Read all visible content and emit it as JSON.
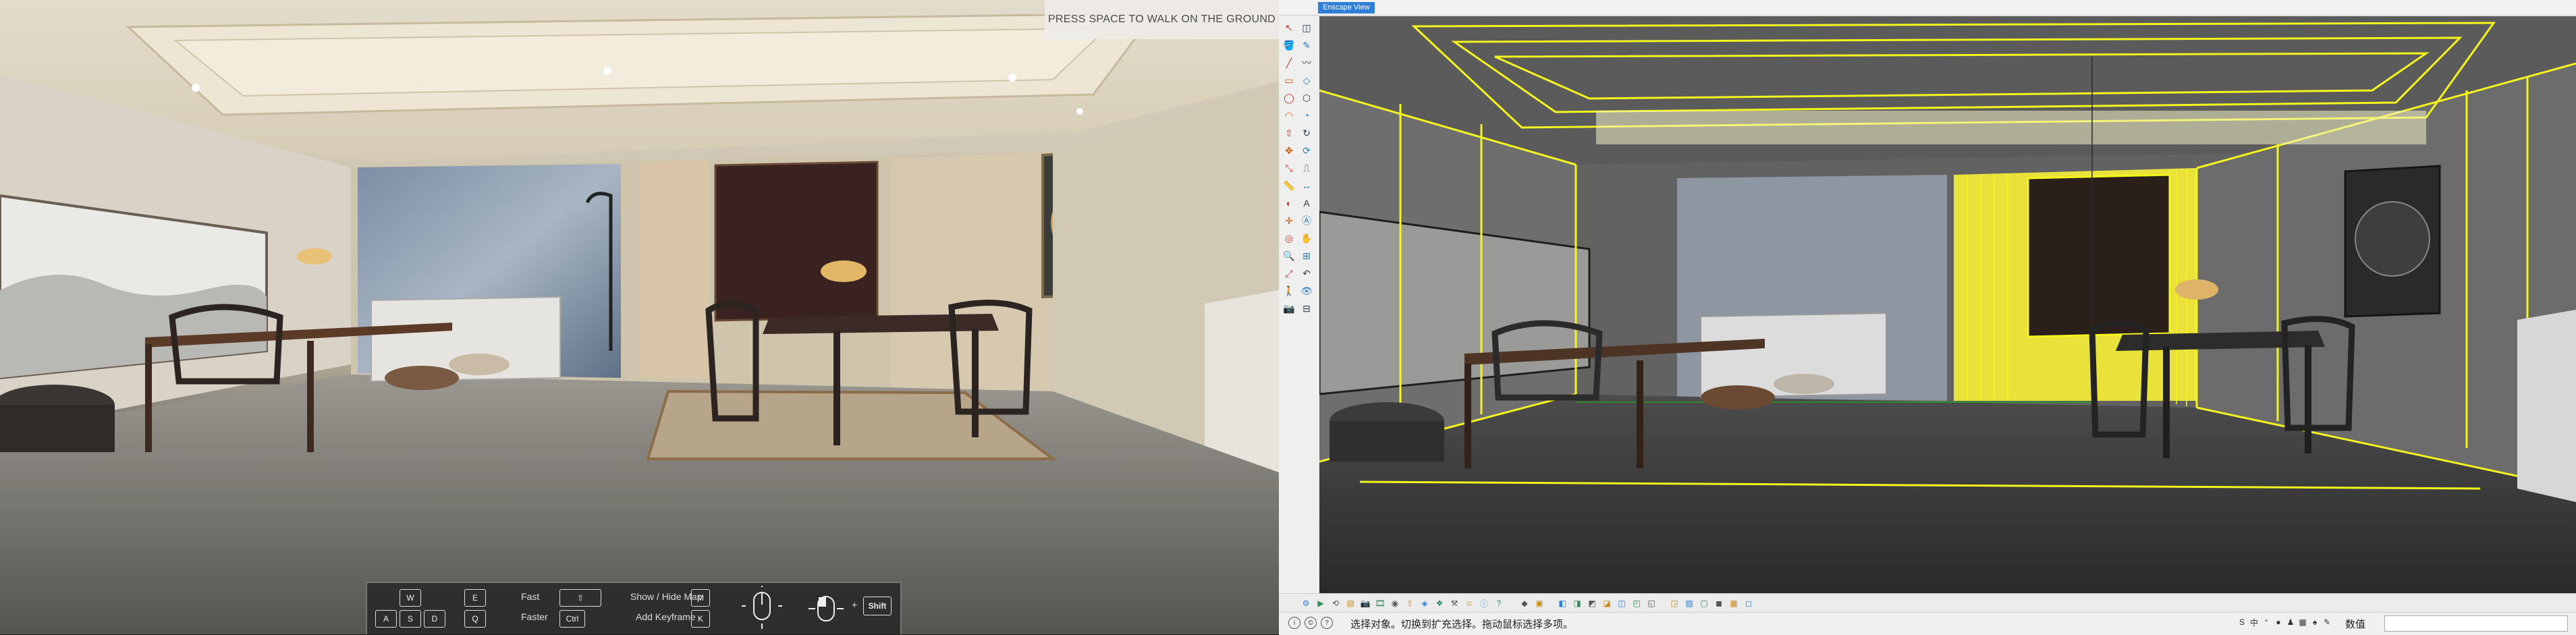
{
  "enscape": {
    "walk_hint": "PRESS SPACE TO WALK ON THE GROUND",
    "controls": {
      "move_keys": [
        "W",
        "E",
        "A",
        "S",
        "D",
        "Q"
      ],
      "fast_label": "Fast",
      "faster_label": "Faster",
      "fast_key": "⇧",
      "faster_key": "Ctrl",
      "show_map_label": "Show / Hide Map",
      "map_key": "M",
      "keyframe_label": "Add Keyframe",
      "keyframe_key": "K",
      "shift_key": "Shift"
    }
  },
  "sketchup": {
    "scene_tab": "Enscape View",
    "status_text": "选择对象。切换到扩充选择。拖动鼠标选择多项。",
    "measurements_label": "数值",
    "measurements_value": "",
    "colors": {
      "edge_highlight": "#f5f51e",
      "selection_blue": "#2f7fd8",
      "axis_blue": "#2a2ad0",
      "axis_green": "#21a021"
    },
    "left_tools": [
      "select-icon",
      "eraser-icon",
      "paint-icon",
      "pencil-icon",
      "line-icon",
      "freehand-icon",
      "rectangle-icon",
      "rotated-rectangle-icon",
      "circle-icon",
      "polygon-icon",
      "arc-icon",
      "pie-icon",
      "push-pull-icon",
      "follow-me-icon",
      "move-icon",
      "rotate-icon",
      "scale-icon",
      "offset-icon",
      "tape-icon",
      "dimension-icon",
      "protractor-icon",
      "text-icon",
      "axes-icon",
      "3d-text-icon",
      "orbit-icon",
      "pan-icon",
      "zoom-icon",
      "zoom-window-icon",
      "zoom-extents-icon",
      "previous-icon",
      "walk-icon",
      "look-around-icon",
      "position-camera-icon",
      "section-icon"
    ],
    "bottom_tools": [
      "settings-icon",
      "enscape-start-icon",
      "enscape-sync-icon",
      "enscape-views-icon",
      "enscape-capture-icon",
      "enscape-video-icon",
      "enscape-panorama-icon",
      "enscape-export-icon",
      "enscape-material-icon",
      "enscape-asset-icon",
      "enscape-settings-icon",
      "enscape-feedback-icon",
      "enscape-info-icon",
      "enscape-about-icon",
      "component-icon",
      "group-icon",
      "iso-view-icon",
      "top-view-icon",
      "front-view-icon",
      "right-view-icon",
      "back-view-icon",
      "left-view-icon",
      "bottom-view-icon",
      "xray-icon",
      "wireframe-icon",
      "hidden-line-icon",
      "shaded-icon",
      "textured-icon",
      "monochrome-icon"
    ]
  }
}
